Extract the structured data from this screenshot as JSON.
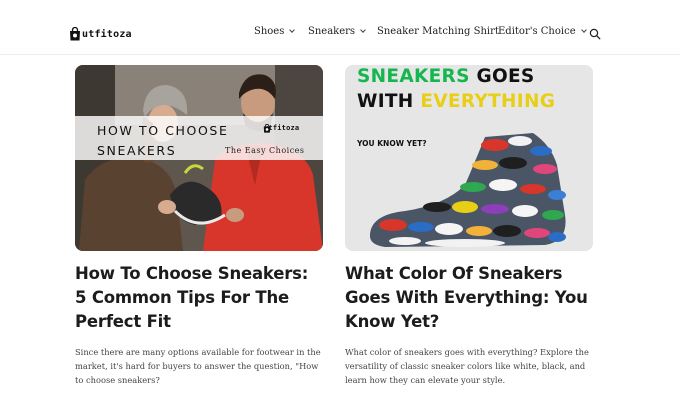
{
  "site": {
    "brand": "utfitoza"
  },
  "nav": {
    "items": [
      {
        "label": "Shoes",
        "dropdown": true
      },
      {
        "label": "Sneakers",
        "dropdown": true
      },
      {
        "label": "Sneaker Matching Shirt",
        "dropdown": false
      },
      {
        "label": "Editor's Choice",
        "dropdown": true
      }
    ],
    "search_icon": "search-icon"
  },
  "posts": [
    {
      "image": {
        "banner_title": "HOW TO CHOOSE SNEAKERS",
        "banner_brand": "utfitoza",
        "banner_subtitle": "The Easy Choices"
      },
      "title": "How To Choose Sneakers: 5 Common Tips For The Perfect Fit",
      "excerpt": "Since there are many options available for footwear in the market, it's hard for buyers to answer the question, \"How to choose sneakers?"
    },
    {
      "image": {
        "headline_word1": "SNEAKERS",
        "headline_word2": "GOES",
        "headline_word3": "WITH",
        "headline_word4": "EVERYTHING",
        "tagline": "YOU KNOW YET?"
      },
      "title": "What Color Of Sneakers Goes With Everything: You Know Yet?",
      "excerpt": "What color of sneakers goes with everything? Explore the versatility of classic sneaker colors like white, black, and learn how they can elevate your style."
    }
  ],
  "colors": {
    "headline_green": "#16b64f",
    "headline_yellow": "#e8cf16",
    "jacket_red": "#d8362a"
  }
}
